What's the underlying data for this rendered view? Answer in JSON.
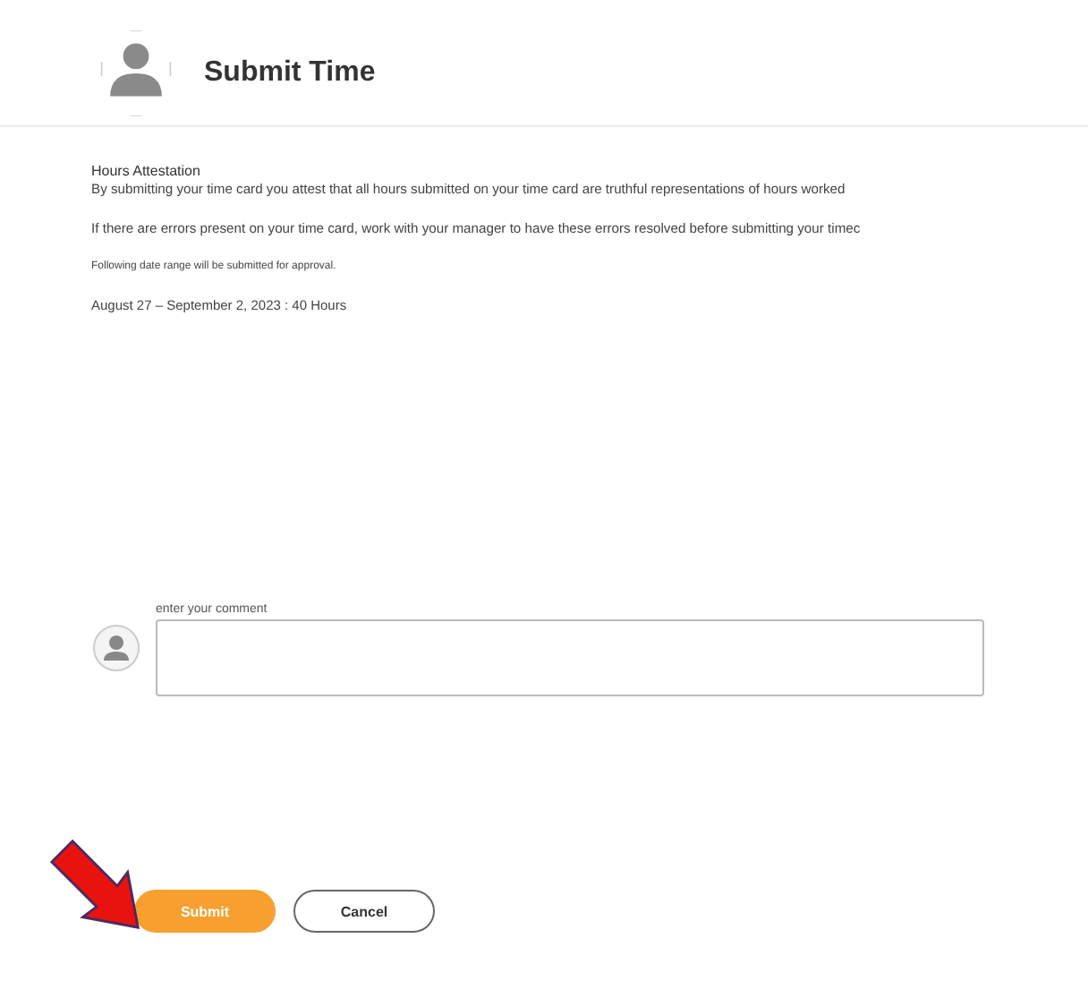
{
  "header": {
    "title": "Submit Time"
  },
  "attestation": {
    "heading": "Hours Attestation",
    "statement": "By submitting your time card you attest that all hours submitted on your time card are truthful representations of hours worked",
    "errors_note": "If there are errors present on your time card, work with your manager to have these errors resolved before submitting your timec",
    "range_note": "Following date range will be submitted for approval.",
    "date_range": "August 27 – September 2, 2023 : 40 Hours"
  },
  "comment": {
    "label": "enter your comment"
  },
  "buttons": [
    {
      "label": "Submit",
      "kind": "primary"
    },
    {
      "label": "Cancel",
      "kind": "secondary"
    }
  ]
}
